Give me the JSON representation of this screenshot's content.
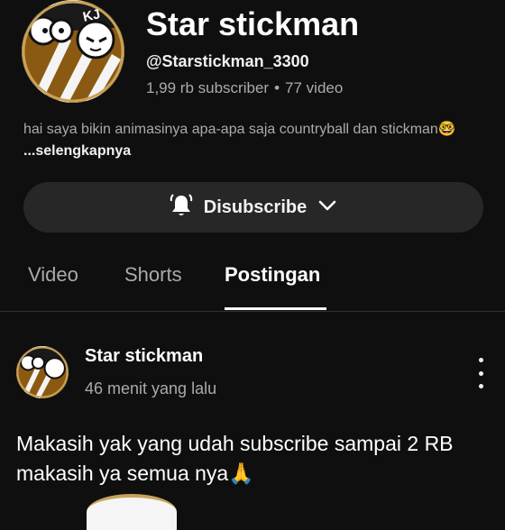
{
  "channel": {
    "name": "Star stickman",
    "handle": "@Starstickman_3300",
    "subscribers": "1,99 rb subscriber",
    "separator": "•",
    "videos": "77 video",
    "description": "hai saya bikin animasinya apa-apa saja countryball dan stickman🤓",
    "more_label": "...selengkapnya",
    "avatar_text": "KJ",
    "colors": {
      "avatar_brown": "#8b5a12",
      "avatar_ring": "#c9a25a"
    }
  },
  "subscribe": {
    "label": "Disubscribe",
    "bell_icon": "bell-icon",
    "chevron_icon": "chevron-down-icon"
  },
  "tabs": [
    {
      "label": "Video",
      "active": false
    },
    {
      "label": "Shorts",
      "active": false
    },
    {
      "label": "Postingan",
      "active": true
    }
  ],
  "post": {
    "author": "Star stickman",
    "time": "46 menit yang lalu",
    "text": "Makasih yak yang udah subscribe sampai 2 RB makasih ya semua nya🙏",
    "menu_icon": "more-vert-icon"
  }
}
